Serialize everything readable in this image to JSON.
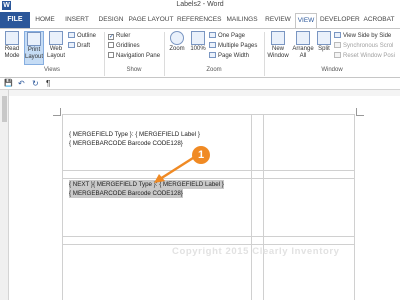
{
  "window": {
    "title": "Labels2 - Word",
    "app_icon": "W"
  },
  "tabs": {
    "file": "FILE",
    "items": [
      "HOME",
      "INSERT",
      "DESIGN",
      "PAGE LAYOUT",
      "REFERENCES",
      "MAILINGS",
      "REVIEW",
      "VIEW",
      "DEVELOPER",
      "ACROBAT"
    ],
    "active": "VIEW"
  },
  "ribbon": {
    "views": {
      "label": "Views",
      "read_mode": "Read Mode",
      "print_layout": "Print Layout",
      "web_layout": "Web Layout",
      "outline": "Outline",
      "draft": "Draft"
    },
    "show": {
      "label": "Show",
      "ruler": {
        "text": "Ruler",
        "checked": true
      },
      "gridlines": {
        "text": "Gridlines",
        "checked": false
      },
      "navigation_pane": {
        "text": "Navigation Pane",
        "checked": false
      }
    },
    "zoom": {
      "label": "Zoom",
      "zoom": "Zoom",
      "hundred": "100%",
      "one_page": "One Page",
      "multiple_pages": "Multiple Pages",
      "page_width": "Page Width"
    },
    "window": {
      "label": "Window",
      "new_window": "New Window",
      "arrange_all": "Arrange All",
      "split": "Split",
      "side_by_side": "View Side by Side",
      "sync_scroll": "Synchronous Scrol",
      "reset_position": "Reset Window Posi"
    }
  },
  "qat": {
    "save": "💾",
    "undo": "↶",
    "redo": "↻",
    "pilcrow": "¶"
  },
  "document": {
    "label1_line1": "{ MERGEFIELD Type }:  { MERGEFIELD Label }",
    "label1_line2": "{ MERGEBARCODE Barcode CODE128}",
    "label2_line1": "{ NEXT }{ MERGEFIELD Type }:  { MERGEFIELD Label }",
    "label2_line2": "{ MERGEBARCODE Barcode CODE128}"
  },
  "callout": {
    "number": "1",
    "color": "#f08a24"
  },
  "watermark": "Copyright 2015 Clearly Inventory",
  "colors": {
    "accent": "#2b579a",
    "highlight": "#c9c9c9"
  }
}
